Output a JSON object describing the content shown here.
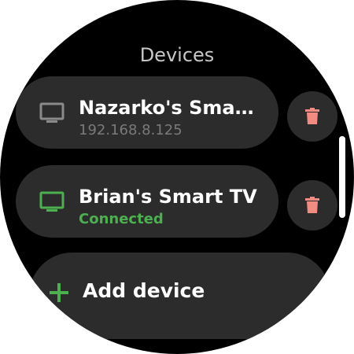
{
  "header": {
    "title": "Devices"
  },
  "devices": [
    {
      "name": "Nazarko's Sma…",
      "status": "192.168.8.125",
      "icon": "tv-icon",
      "icon_color": "#8a8a8a",
      "status_color": "#7a7a7a"
    },
    {
      "name": "Brian's Smart TV",
      "status": "Connected",
      "icon": "tv-icon",
      "icon_color": "#4caf50",
      "status_color": "#4caf50"
    }
  ],
  "actions": {
    "delete_icon": "trash-icon",
    "delete_color": "#f28b82"
  },
  "add_device": {
    "label": "Add device",
    "icon": "plus-icon",
    "icon_color": "#4caf50"
  }
}
